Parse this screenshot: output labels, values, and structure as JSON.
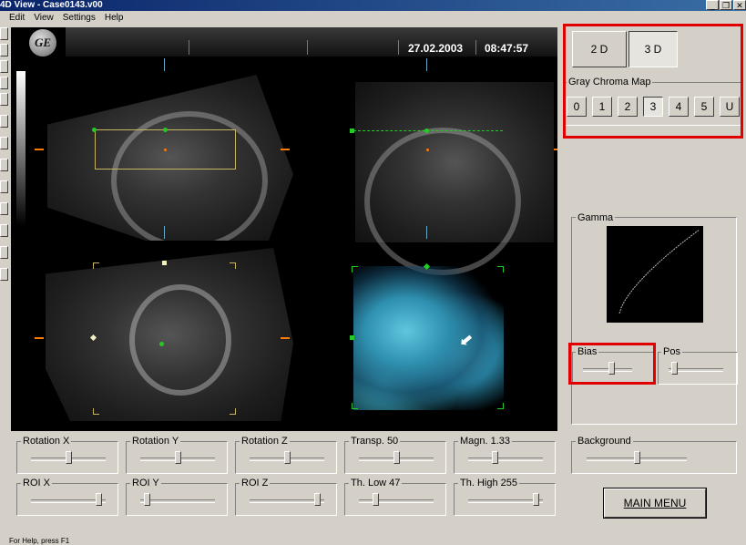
{
  "window": {
    "title": "4D View - Case0143.v00",
    "buttons": [
      "_",
      "❐",
      "✕"
    ]
  },
  "menubar": {
    "items": [
      "Edit",
      "View",
      "Settings",
      "Help"
    ]
  },
  "viewer": {
    "date": "27.02.2003",
    "time": "08:47:57",
    "logo": "GE"
  },
  "right_panel": {
    "mode_buttons": {
      "two_d": "2 D",
      "three_d": "3 D",
      "selected": "3 D"
    },
    "gray_chroma_map": {
      "label": "Gray Chroma Map",
      "buttons": [
        "0",
        "1",
        "2",
        "3",
        "4",
        "5",
        "U"
      ],
      "selected": "3"
    },
    "gamma": {
      "label": "Gamma"
    },
    "bias": {
      "label": "Bias",
      "value": 0.6
    },
    "pos": {
      "label": "Pos",
      "value": 0.05
    },
    "background": {
      "label": "Background",
      "value": 0.5
    }
  },
  "sliders_row1": [
    {
      "label": "Rotation X",
      "value": 0.5
    },
    {
      "label": "Rotation Y",
      "value": 0.5
    },
    {
      "label": "Rotation Z",
      "value": 0.5
    },
    {
      "label": "Transp. 50",
      "value": 0.5
    },
    {
      "label": "Magn. 1.33",
      "value": 0.35
    }
  ],
  "sliders_row2": [
    {
      "label": "ROI X",
      "value": 0.95
    },
    {
      "label": "ROI Y",
      "value": 0.05
    },
    {
      "label": "ROI  Z",
      "value": 0.95
    },
    {
      "label": "Th. Low 47",
      "value": 0.2
    },
    {
      "label": "Th. High 255",
      "value": 0.95
    }
  ],
  "main_menu_button": "MAIN MENU",
  "status": "For Help, press F1",
  "colors": {
    "highlight": "#e00000",
    "render": "#3aa6c0",
    "roi_box": "#c8b560",
    "marker": "#22cc22",
    "orange": "#ff7a00"
  }
}
